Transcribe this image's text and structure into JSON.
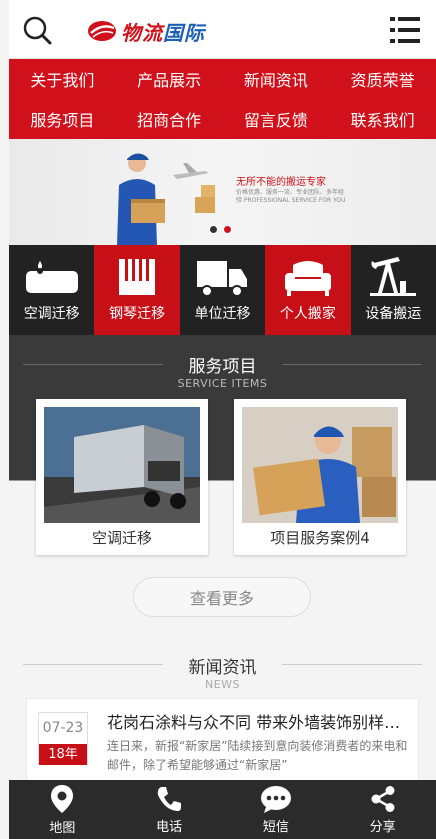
{
  "header": {
    "logo_text_a": "物流",
    "logo_text_b": "国际"
  },
  "nav": {
    "items": [
      "关于我们",
      "产品展示",
      "新闻资讯",
      "资质荣誉",
      "服务项目",
      "招商合作",
      "留言反馈",
      "联系我们"
    ]
  },
  "banner": {
    "title": "无所不能的搬运专家",
    "subtitle": "价格优惠、服务一流、专业团队、多年经验 PROFESSIONAL SERVICE FOR YOU"
  },
  "services": {
    "items": [
      {
        "label": "空调迁移",
        "icon": "ac-icon"
      },
      {
        "label": "钢琴迁移",
        "icon": "piano-icon"
      },
      {
        "label": "单位迁移",
        "icon": "truck-icon"
      },
      {
        "label": "个人搬家",
        "icon": "sofa-icon"
      },
      {
        "label": "设备搬运",
        "icon": "oil-pump-icon"
      }
    ]
  },
  "service_section": {
    "title_cn": "服务项目",
    "title_en": "SERVICE ITEMS",
    "cards": [
      {
        "label": "空调迁移"
      },
      {
        "label": "项目服务案例4"
      }
    ],
    "more_label": "查看更多"
  },
  "news_section": {
    "title_cn": "新闻资讯",
    "title_en": "NEWS",
    "items": [
      {
        "date_md": "07-23",
        "date_y": "18年",
        "title": "花岗石涂料与众不同 带来外墙装饰别样风采",
        "summary": "连日来，新报“新家居”陆续接到意向装修消费者的来电和邮件，除了希望能够通过“新家居”"
      }
    ]
  },
  "bottom_bar": {
    "tabs": [
      "地图",
      "电话",
      "短信",
      "分享"
    ]
  },
  "colors": {
    "brand_red": "#d0111b",
    "dark": "#222222",
    "logo_blue": "#1c5fb8"
  }
}
